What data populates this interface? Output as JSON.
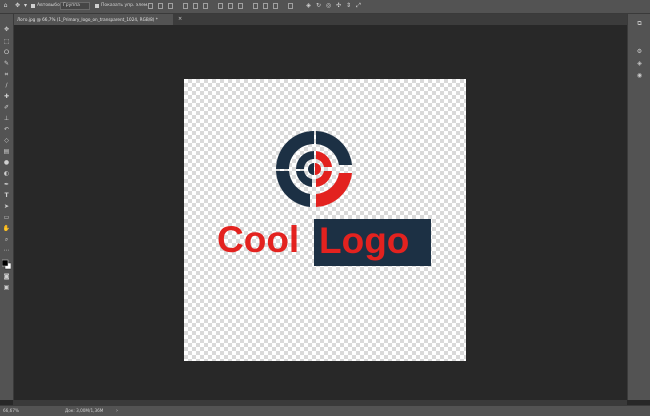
{
  "options_bar": {
    "autoselect_label": "Автовыбор:",
    "autoselect_value": "Группа",
    "transform_label": "Показать упр. элем."
  },
  "document_tab": {
    "title": "Лого.jpg @ 66,7% (1_Primary_logo_on_transparent_1024, RGB/8) *",
    "close_glyph": "×"
  },
  "canvas": {
    "logo_word_1": "Cool",
    "logo_word_2": "Logo",
    "colors": {
      "red": "#e3221f",
      "navy": "#1c3044"
    }
  },
  "status": {
    "zoom": "66,67%",
    "doc_info": "Док: 3,00M/1,36M",
    "arrow": "›"
  },
  "toolbar_icons": [
    "move-icon",
    "marquee-icon",
    "lasso-icon",
    "quick-select-icon",
    "crop-icon",
    "eyedropper-icon",
    "healing-brush-icon",
    "brush-icon",
    "clone-stamp-icon",
    "history-brush-icon",
    "eraser-icon",
    "gradient-icon",
    "blur-icon",
    "dodge-icon",
    "pen-icon",
    "type-icon",
    "path-select-icon",
    "shape-icon",
    "hand-icon",
    "zoom-icon",
    "more-tools-icon",
    "color-swatches-icon",
    "quick-mask-icon",
    "screen-mode-icon"
  ],
  "dock_icons": [
    "history-panel-icon",
    "properties-panel-icon",
    "layers-panel-icon",
    "channels-panel-icon"
  ]
}
